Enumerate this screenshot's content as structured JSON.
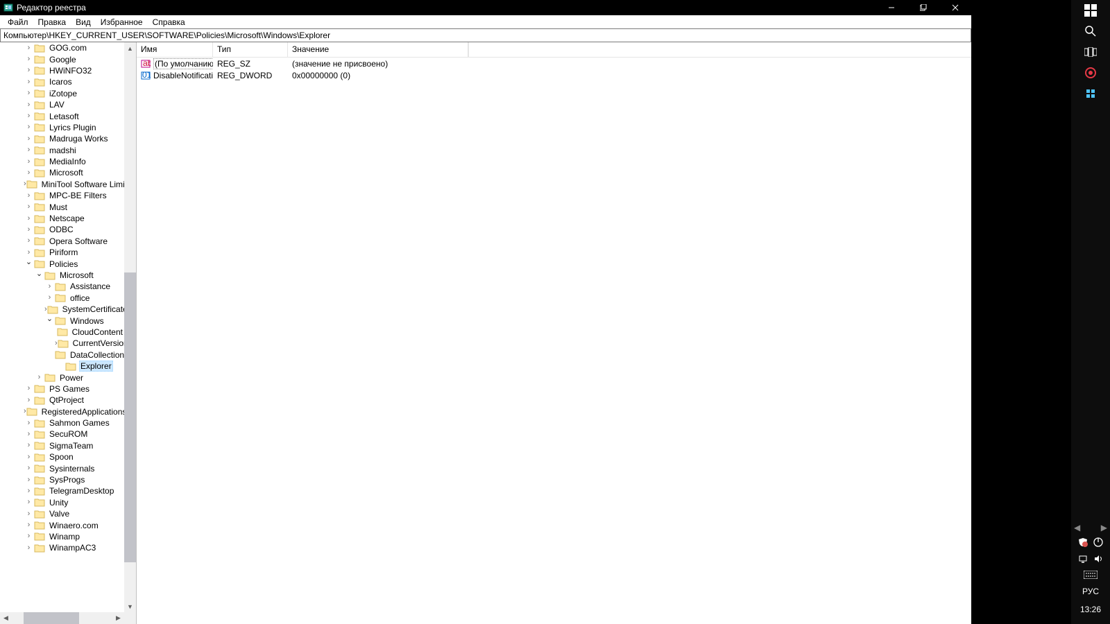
{
  "window": {
    "title": "Редактор реестра",
    "minimize": "–",
    "maximize": "❐",
    "close": "✕"
  },
  "menu": [
    "Файл",
    "Правка",
    "Вид",
    "Избранное",
    "Справка"
  ],
  "address": "Компьютер\\HKEY_CURRENT_USER\\SOFTWARE\\Policies\\Microsoft\\Windows\\Explorer",
  "columns": {
    "name": "Имя",
    "type": "Тип",
    "value": "Значение"
  },
  "values": [
    {
      "icon": "sz",
      "name": "(По умолчанию)",
      "type": "REG_SZ",
      "value": "(значение не присвоено)",
      "selected": true
    },
    {
      "icon": "dw",
      "name": "DisableNotificati...",
      "type": "REG_DWORD",
      "value": "0x00000000 (0)",
      "selected": false
    }
  ],
  "tree": [
    {
      "d": 2,
      "exp": ">",
      "name": "GOG.com"
    },
    {
      "d": 2,
      "exp": ">",
      "name": "Google"
    },
    {
      "d": 2,
      "exp": ">",
      "name": "HWiNFO32"
    },
    {
      "d": 2,
      "exp": ">",
      "name": "Icaros"
    },
    {
      "d": 2,
      "exp": ">",
      "name": "iZotope"
    },
    {
      "d": 2,
      "exp": ">",
      "name": "LAV"
    },
    {
      "d": 2,
      "exp": ">",
      "name": "Letasoft"
    },
    {
      "d": 2,
      "exp": ">",
      "name": "Lyrics Plugin"
    },
    {
      "d": 2,
      "exp": ">",
      "name": "Madruga Works"
    },
    {
      "d": 2,
      "exp": ">",
      "name": "madshi"
    },
    {
      "d": 2,
      "exp": ">",
      "name": "MediaInfo"
    },
    {
      "d": 2,
      "exp": ">",
      "name": "Microsoft"
    },
    {
      "d": 2,
      "exp": ">",
      "name": "MiniTool Software Limited"
    },
    {
      "d": 2,
      "exp": ">",
      "name": "MPC-BE Filters"
    },
    {
      "d": 2,
      "exp": ">",
      "name": "Must"
    },
    {
      "d": 2,
      "exp": ">",
      "name": "Netscape"
    },
    {
      "d": 2,
      "exp": ">",
      "name": "ODBC"
    },
    {
      "d": 2,
      "exp": ">",
      "name": "Opera Software"
    },
    {
      "d": 2,
      "exp": ">",
      "name": "Piriform"
    },
    {
      "d": 2,
      "exp": "v",
      "name": "Policies"
    },
    {
      "d": 3,
      "exp": "v",
      "name": "Microsoft"
    },
    {
      "d": 4,
      "exp": ">",
      "name": "Assistance"
    },
    {
      "d": 4,
      "exp": ">",
      "name": "office"
    },
    {
      "d": 4,
      "exp": ">",
      "name": "SystemCertificates"
    },
    {
      "d": 4,
      "exp": "v",
      "name": "Windows"
    },
    {
      "d": 5,
      "exp": " ",
      "name": "CloudContent"
    },
    {
      "d": 5,
      "exp": ">",
      "name": "CurrentVersion"
    },
    {
      "d": 5,
      "exp": " ",
      "name": "DataCollection"
    },
    {
      "d": 5,
      "exp": " ",
      "name": "Explorer",
      "selected": true
    },
    {
      "d": 3,
      "exp": ">",
      "name": "Power"
    },
    {
      "d": 2,
      "exp": ">",
      "name": "PS Games"
    },
    {
      "d": 2,
      "exp": ">",
      "name": "QtProject"
    },
    {
      "d": 2,
      "exp": ">",
      "name": "RegisteredApplications"
    },
    {
      "d": 2,
      "exp": ">",
      "name": "Sahmon Games"
    },
    {
      "d": 2,
      "exp": ">",
      "name": "SecuROM"
    },
    {
      "d": 2,
      "exp": ">",
      "name": "SigmaTeam"
    },
    {
      "d": 2,
      "exp": ">",
      "name": "Spoon"
    },
    {
      "d": 2,
      "exp": ">",
      "name": "Sysinternals"
    },
    {
      "d": 2,
      "exp": ">",
      "name": "SysProgs"
    },
    {
      "d": 2,
      "exp": ">",
      "name": "TelegramDesktop"
    },
    {
      "d": 2,
      "exp": ">",
      "name": "Unity"
    },
    {
      "d": 2,
      "exp": ">",
      "name": "Valve"
    },
    {
      "d": 2,
      "exp": ">",
      "name": "Winaero.com"
    },
    {
      "d": 2,
      "exp": ">",
      "name": "Winamp"
    },
    {
      "d": 2,
      "exp": ">",
      "name": "WinampAC3"
    }
  ],
  "taskbar": {
    "lang": "РУС",
    "clock": "13:26"
  }
}
